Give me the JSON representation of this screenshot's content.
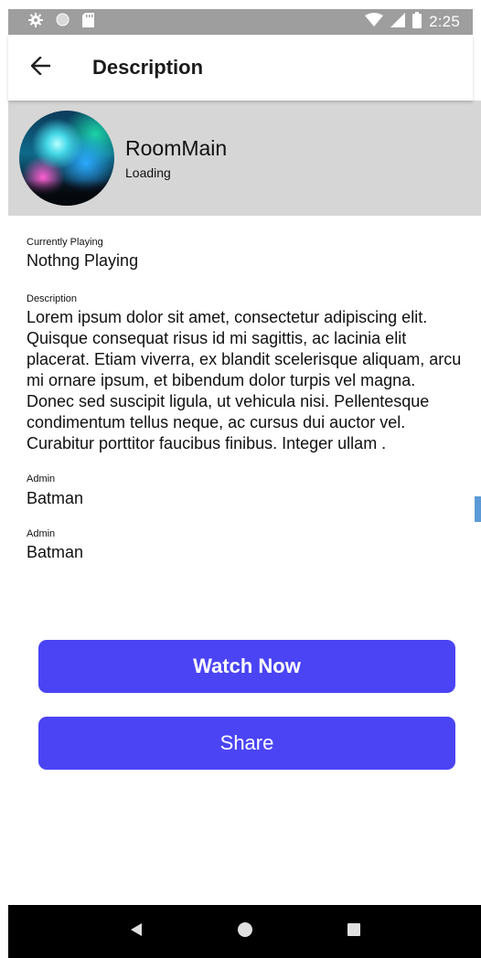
{
  "status_bar": {
    "time": "2:25",
    "icons": [
      "gear-icon",
      "circle-icon",
      "sd-card-icon",
      "wifi-icon",
      "signal-icon",
      "battery-icon"
    ]
  },
  "app_bar": {
    "title": "Description",
    "back_icon": "arrow-back-icon"
  },
  "room": {
    "name": "RoomMain",
    "status": "Loading"
  },
  "details": {
    "currently_playing_label": "Currently Playing",
    "currently_playing_value": "Nothng Playing",
    "description_label": "Description",
    "description_value": "Lorem ipsum dolor sit amet, consectetur adipiscing elit. Quisque consequat risus id mi sagittis, ac lacinia elit placerat. Etiam viverra, ex blandit scelerisque aliquam, arcu mi ornare ipsum, et bibendum dolor turpis vel magna. Donec sed suscipit ligula, ut vehicula nisi. Pellentesque condimentum tellus neque, ac cursus dui auctor vel. Curabitur porttitor faucibus finibus. Integer ullam .",
    "admin_1_label": "Admin",
    "admin_1_value": "Batman",
    "admin_2_label": "Admin",
    "admin_2_value": "Batman"
  },
  "actions": {
    "watch_label": "Watch Now",
    "share_label": "Share"
  },
  "colors": {
    "primary_button": "#4b44f5",
    "header_background": "#d6d6d6",
    "status_bar": "#9e9e9e",
    "nav_bar": "#000000"
  },
  "nav_bar": {
    "icons": [
      "back-triangle-icon",
      "home-circle-icon",
      "recents-square-icon"
    ]
  }
}
